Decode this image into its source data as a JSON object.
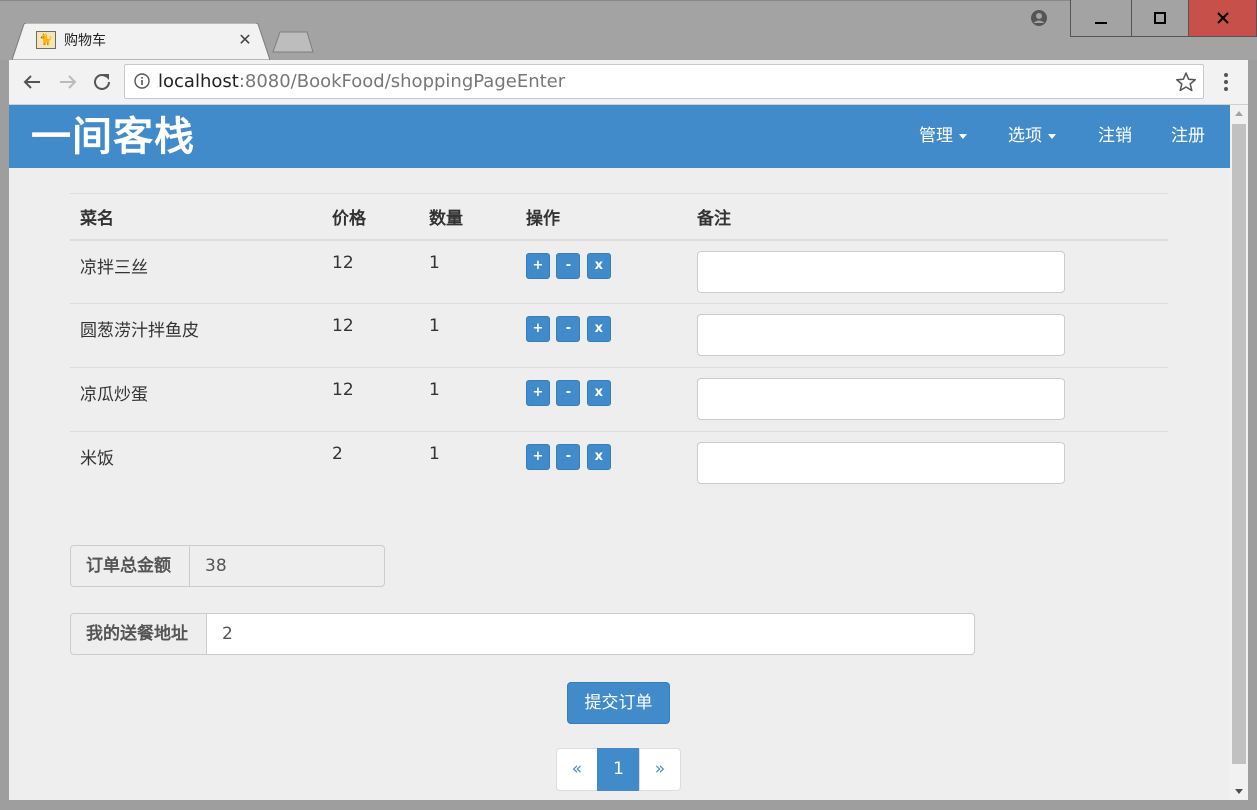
{
  "browser": {
    "tab_title": "购物车",
    "tab_icon_glyph": "🐈",
    "url_host": "localhost",
    "url_rest": ":8080/BookFood/shoppingPageEnter"
  },
  "navbar": {
    "brand": "一间客栈",
    "links": [
      "管理",
      "选项",
      "注销",
      "注册"
    ],
    "color": "#428bca"
  },
  "table": {
    "headers": [
      "菜名",
      "价格",
      "数量",
      "操作",
      "备注"
    ],
    "rows": [
      {
        "name": "凉拌三丝",
        "price": "12",
        "qty": "1",
        "remark": ""
      },
      {
        "name": "圆葱涝汁拌鱼皮",
        "price": "12",
        "qty": "1",
        "remark": ""
      },
      {
        "name": "凉瓜炒蛋",
        "price": "12",
        "qty": "1",
        "remark": ""
      },
      {
        "name": "米饭",
        "price": "2",
        "qty": "1",
        "remark": ""
      }
    ],
    "ops": [
      "+",
      "-",
      "x"
    ]
  },
  "order": {
    "total_label": "订单总金额",
    "total_value": "38",
    "address_label": "我的送餐地址",
    "address_value": "2",
    "submit_label": "提交订单"
  },
  "pagination": {
    "prev": "«",
    "current": "1",
    "next": "»"
  }
}
